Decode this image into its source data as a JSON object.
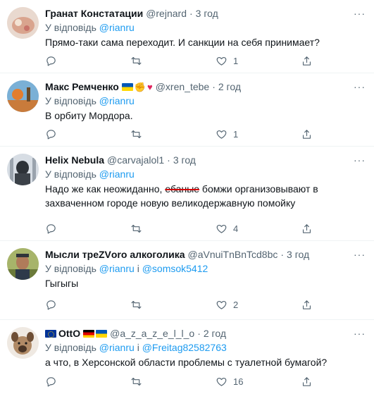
{
  "reply_prefix": "У відповідь",
  "conj": "і",
  "dot": "·",
  "more_label": "···",
  "tweets": [
    {
      "name": "Гранат Констатации",
      "handle": "@rejnard",
      "time": "3 год",
      "mention1": "@rianru",
      "text": "Прямо-таки сама переходит. И санкции на себя принимает?",
      "likes": "1"
    },
    {
      "name": "Макс Ремченко",
      "handle": "@xren_tebe",
      "time": "2 год",
      "mention1": "@rianru",
      "text": "В орбиту Мордора.",
      "likes": "1"
    },
    {
      "name": "Helix Nebula",
      "handle": "@carvajalol1",
      "time": "3 год",
      "mention1": "@rianru",
      "text_before": "Надо же как неожиданно, ",
      "text_struck": "ебаные",
      "text_after": " бомжи организовывают в захваченном городе новую великодержавную помойку",
      "likes": "4"
    },
    {
      "name": "Мысли треZVоro алкоголика",
      "handle": "@aVnuiTnBnTcd8bc",
      "time": "3 год",
      "mention1": "@rianru",
      "mention2": "@somsok5412",
      "text": "Гыгыгы",
      "likes": "2"
    },
    {
      "name": "OttO",
      "handle": "@a_z_a_z_e_l_l_o",
      "time": "2 год",
      "mention1": "@rianru",
      "mention2": "@Freitag82582763",
      "text": "а что, в Херсонской области проблемы с туалетной бумагой?",
      "likes": "16"
    }
  ]
}
